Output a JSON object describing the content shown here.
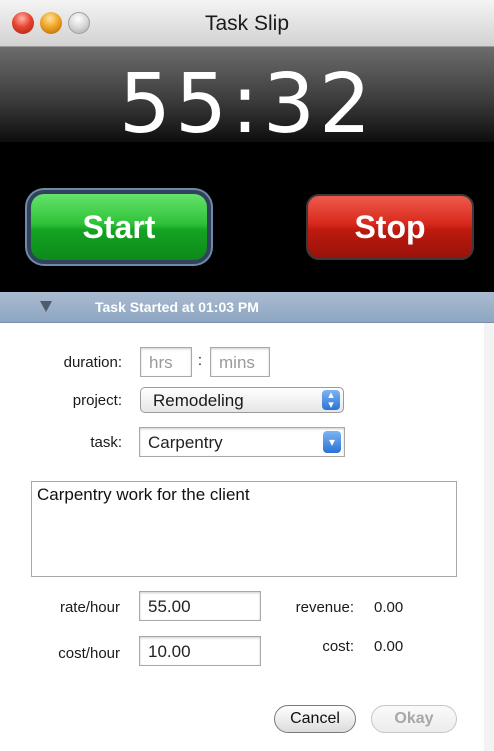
{
  "window": {
    "title": "Task Slip"
  },
  "timer": {
    "display": "55:32"
  },
  "buttons": {
    "start": "Start",
    "stop": "Stop",
    "cancel": "Cancel",
    "okay": "Okay"
  },
  "disclosure": {
    "label": "Task Started at 01:03 PM"
  },
  "form": {
    "duration_label": "duration:",
    "hrs_placeholder": "hrs",
    "separator": ":",
    "mins_placeholder": "mins",
    "project_label": "project:",
    "project_value": "Remodeling",
    "task_label": "task:",
    "task_value": "Carpentry",
    "notes": "Carpentry work for the client",
    "rate_label": "rate/hour",
    "rate_value": "55.00",
    "cost_rate_label": "cost/hour",
    "cost_rate_value": "10.00",
    "revenue_label": "revenue:",
    "revenue_value": "0.00",
    "cost_label": "cost:",
    "cost_value": "0.00"
  },
  "colors": {
    "start": "#14a323",
    "stop": "#bd1a0e",
    "header_bar": "#8ea6c2",
    "select_arrow": "#2a73d6"
  }
}
